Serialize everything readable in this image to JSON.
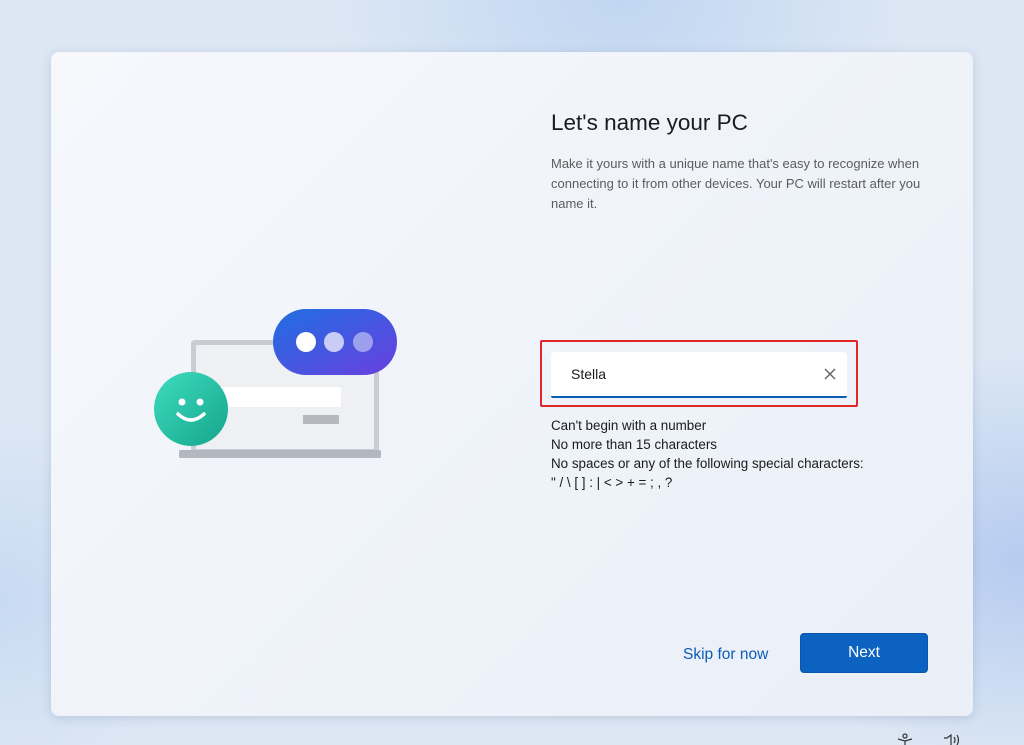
{
  "page": {
    "title": "Let's name your PC",
    "description": "Make it yours with a unique name that's easy to recognize when connecting to it from other devices. Your PC will restart after you name it."
  },
  "name_field": {
    "value": "Stella",
    "clear_icon": "close-icon"
  },
  "rules": [
    "Can't begin with a number",
    "No more than 15 characters",
    "No spaces or any of the following special characters:",
    "\" / \\ [ ] : | < > + = ; , ?"
  ],
  "buttons": {
    "skip_label": "Skip for now",
    "next_label": "Next"
  },
  "tray_icons": [
    "accessibility-icon",
    "volume-icon"
  ],
  "colors": {
    "accent": "#0b62c0",
    "link": "#0b5cb5",
    "highlight_border": "#e02626"
  }
}
